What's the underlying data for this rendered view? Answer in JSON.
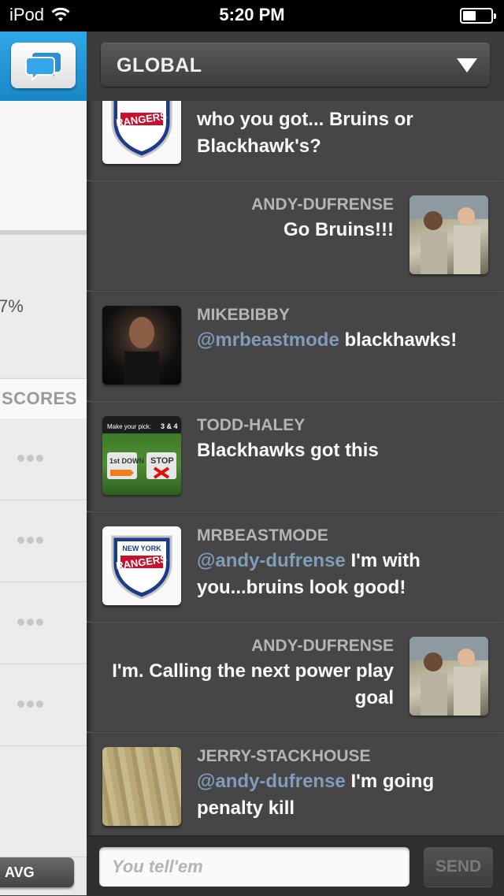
{
  "status_bar": {
    "carrier": "iPod",
    "time": "5:20 PM"
  },
  "left_panel": {
    "percent_partial": "7%",
    "scores_label": "SCORES",
    "avg_label": "AVG"
  },
  "header": {
    "channel": "GLOBAL"
  },
  "messages": [
    {
      "side": "left",
      "user": "",
      "text": "who you got... Bruins or Blackhawk's?",
      "avatar": "rangers-logo"
    },
    {
      "side": "right",
      "user": "ANDY-DUFRENSE",
      "text": "Go Bruins!!!",
      "avatar": "two-men-photo"
    },
    {
      "side": "left",
      "user": "MIKEBIBBY",
      "mention": "@mrbeastmode",
      "text": "blackhawks!",
      "avatar": "man-portrait"
    },
    {
      "side": "left",
      "user": "TODD-HALEY",
      "text": "Blackhawks got this",
      "avatar": "football-game-screen"
    },
    {
      "side": "left",
      "user": "MRBEASTMODE",
      "mention": "@andy-dufrense",
      "text": "I'm with you...bruins look good!",
      "avatar": "rangers-logo"
    },
    {
      "side": "right",
      "user": "ANDY-DUFRENSE",
      "text": "I'm. Calling the next power play goal",
      "avatar": "two-men-photo"
    },
    {
      "side": "left",
      "user": "JERRY-STACKHOUSE",
      "mention": "@andy-dufrense",
      "text": "I'm going penalty kill",
      "avatar": "wood-floor"
    }
  ],
  "game_thumb": {
    "pick_label": "Make your pick:",
    "score": "3 & 4",
    "down_label": "1st DOWN",
    "stop_label": "STOP"
  },
  "rangers_logo": {
    "line1": "NEW YORK",
    "line2": "RANGERS"
  },
  "compose": {
    "placeholder": "You tell'em",
    "send_label": "SEND"
  },
  "colors": {
    "accent_blue": "#1e90d4",
    "mention": "#7f9cbb",
    "panel_dark": "#464646"
  }
}
